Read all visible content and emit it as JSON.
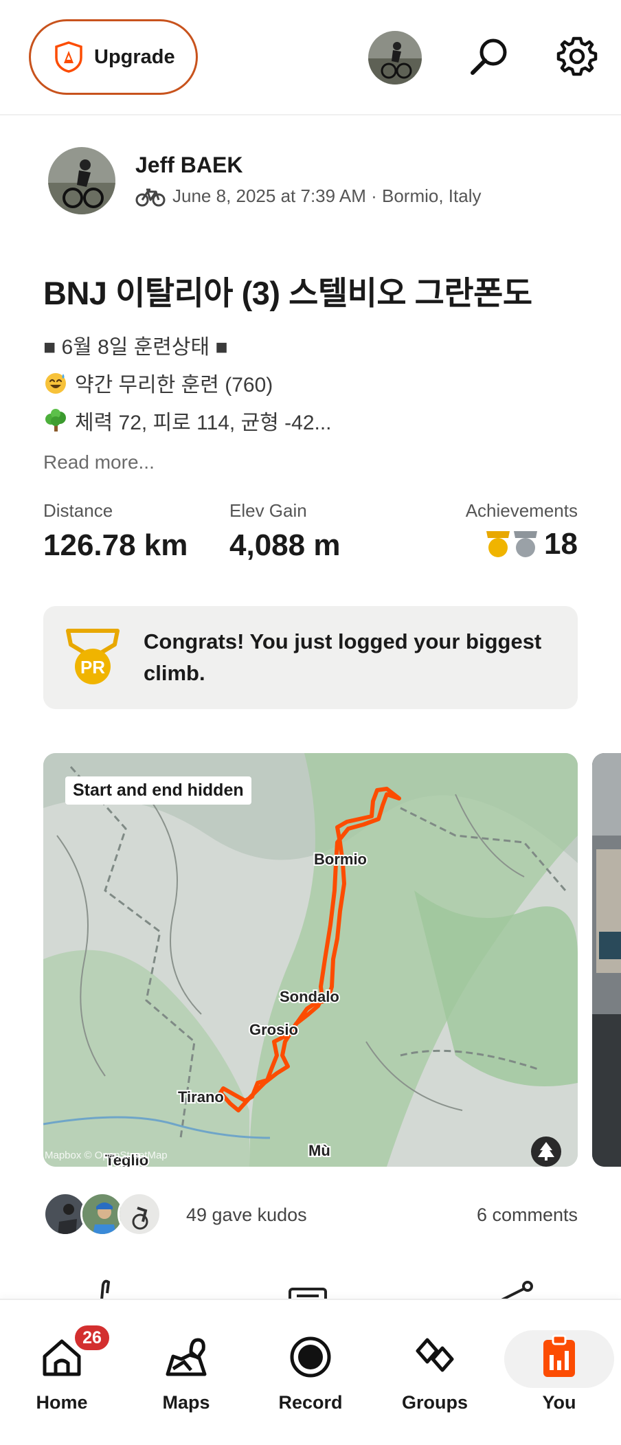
{
  "topbar": {
    "upgrade_label": "Upgrade",
    "icons": [
      "upgrade-shield-icon",
      "profile-avatar",
      "search-icon",
      "gear-icon"
    ]
  },
  "activity": {
    "athlete_name": "Jeff BAEK",
    "meta": "June 8, 2025 at 7:39 AM · Bormio, Italy",
    "sport_icon": "bike-icon",
    "title": "BNJ 이탈리아 (3) 스텔비오 그란폰도",
    "description": [
      {
        "text": "■ 6월 8일 훈련상태 ■",
        "icon": ""
      },
      {
        "text": "약간 무리한 훈련 (760)",
        "icon": "sweat-smile-emoji"
      },
      {
        "text": "체력 72, 피로 114, 균형 -42...",
        "icon": "tree-emoji"
      }
    ],
    "read_more": "Read more...",
    "stats": {
      "distance_label": "Distance",
      "distance_value": "126.78 km",
      "elev_label": "Elev Gain",
      "elev_value": "4,088 m",
      "achievements_label": "Achievements",
      "achievements_value": "18"
    },
    "congrats": "Congrats! You just logged your biggest climb.",
    "pr_label": "PR"
  },
  "map": {
    "privacy_label": "Start and end hidden",
    "places": {
      "bormio": "Bormio",
      "sondalo": "Sondalo",
      "grosio": "Grosio",
      "tirano": "Tirano",
      "teglio": "Teglio",
      "mu": "Mù"
    },
    "attribution": "Mapbox © OpenStreetMap",
    "route_color": "#fc4c02"
  },
  "social": {
    "kudos": "49 gave kudos",
    "comments": "6 comments"
  },
  "tabbar": {
    "home": "Home",
    "home_badge": "26",
    "maps": "Maps",
    "record": "Record",
    "groups": "Groups",
    "you": "You",
    "active_color": "#fc4c02"
  }
}
